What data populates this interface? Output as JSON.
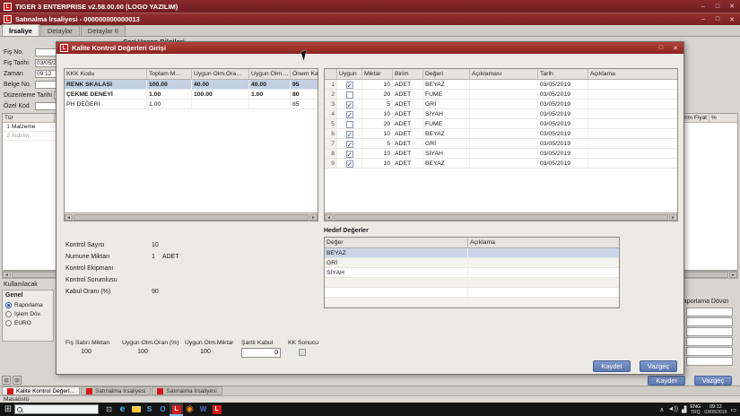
{
  "app": {
    "titlebar": "TIGER 3 ENTERPRISE v2.58.00.00 (LOGO YAZILIM)",
    "document_title": "Satınalma İrsaliyesi - 000000000000013",
    "window_controls": {
      "minimize": "–",
      "maximize": "□",
      "close": "✕"
    }
  },
  "glyphs": {
    "logo_letter": "L",
    "left": "◄",
    "right": "►",
    "tile": "▦",
    "chevron": "∧",
    "volume": "◄))",
    "network": "▟",
    "notification": "▭"
  },
  "doc_tabs": [
    {
      "label": "İrsaliye",
      "selected": true
    },
    {
      "label": "Detaylar"
    },
    {
      "label": "Detaylar II"
    }
  ],
  "form": {
    "section_title": "Cari Hesap Bilgileri",
    "fields": [
      {
        "label": "Fiş No.",
        "value": ""
      },
      {
        "label": "Fiş Tarihi",
        "value": "03/05/2019"
      },
      {
        "label": "Zaman",
        "value": "09:12"
      },
      {
        "label": "Belge No.",
        "value": ""
      },
      {
        "label": "Düzenleme Tarihi",
        "value": ""
      },
      {
        "label": "Özel Kod",
        "value": ""
      }
    ],
    "lines_grid": {
      "tur_header": "Tür",
      "rows": [
        {
          "no": "1",
          "tur": "Malzeme"
        },
        {
          "no": "2",
          "tur": "İndirim",
          "muted": true
        }
      ],
      "right_columns": [
        "Birim Fiyat",
        "%"
      ]
    },
    "currency_panel": {
      "title": "Kullanılacak",
      "group_label": "Genel",
      "options": [
        {
          "label": "Raporlama",
          "selected": true
        },
        {
          "label": "İşlem Döv."
        },
        {
          "label": "EURO"
        }
      ]
    },
    "right_label": "Raporlama Dövizi",
    "buttons": {
      "save": "Kaydet",
      "cancel": "Vazgeç"
    }
  },
  "dialog": {
    "title": "Kalite Kontrol Değerleri Girişi",
    "kkk_grid": {
      "columns": [
        "KKK Kodu",
        "Toplam M...",
        "Uygun Olm.Ora...",
        "Uygun Olm....",
        "Önem Kat..."
      ],
      "rows": [
        {
          "kod": "RENK SKALASI",
          "toplam": "100.00",
          "uygun_oran": "40.00",
          "uygun_miktar": "40.00",
          "onem": "95",
          "selected": true,
          "bold": true
        },
        {
          "kod": "ÇEKME DENEYİ",
          "toplam": "1.00",
          "uygun_oran": "100.00",
          "uygun_miktar": "1.00",
          "onem": "80",
          "bold": true
        },
        {
          "kod": "PH DEĞERİ",
          "toplam": "1.00",
          "uygun_oran": "",
          "uygun_miktar": "",
          "onem": "85"
        }
      ]
    },
    "detail_grid": {
      "columns": [
        "",
        "Uygun",
        "Miktar",
        "Birim",
        "Değeri",
        "Açıklaması",
        "Tarih",
        "Açıklama"
      ],
      "rows": [
        {
          "no": "1",
          "uygun": true,
          "miktar": "10",
          "birim": "ADET",
          "degeri": "BEYAZ",
          "aciklamasi": "",
          "tarih": "03/05/2019",
          "aciklama": ""
        },
        {
          "no": "2",
          "uygun": false,
          "miktar": "20",
          "birim": "ADET",
          "degeri": "FUME",
          "aciklamasi": "",
          "tarih": "03/05/2019",
          "aciklama": ""
        },
        {
          "no": "3",
          "uygun": true,
          "miktar": "5",
          "birim": "ADET",
          "degeri": "GRİ",
          "aciklamasi": "",
          "tarih": "03/05/2019",
          "aciklama": ""
        },
        {
          "no": "4",
          "uygun": true,
          "miktar": "10",
          "birim": "ADET",
          "degeri": "SİYAH",
          "aciklamasi": "",
          "tarih": "03/05/2019",
          "aciklama": ""
        },
        {
          "no": "5",
          "uygun": false,
          "miktar": "20",
          "birim": "ADET",
          "degeri": "FUME",
          "aciklamasi": "",
          "tarih": "03/05/2019",
          "aciklama": ""
        },
        {
          "no": "6",
          "uygun": true,
          "miktar": "10",
          "birim": "ADET",
          "degeri": "BEYAZ",
          "aciklamasi": "",
          "tarih": "03/05/2019",
          "aciklama": ""
        },
        {
          "no": "7",
          "uygun": true,
          "miktar": "5",
          "birim": "ADET",
          "degeri": "GRİ",
          "aciklamasi": "",
          "tarih": "03/05/2019",
          "aciklama": ""
        },
        {
          "no": "8",
          "uygun": true,
          "miktar": "10",
          "birim": "ADET",
          "degeri": "SİYAH",
          "aciklamasi": "",
          "tarih": "03/05/2019",
          "aciklama": ""
        },
        {
          "no": "9",
          "uygun": true,
          "miktar": "10",
          "birim": "ADET",
          "degeri": "BEYAZ",
          "aciklamasi": "",
          "tarih": "03/05/2019",
          "aciklama": ""
        }
      ]
    },
    "info_fields": [
      {
        "label": "Kontrol Sayısı",
        "value": "10",
        "unit": ""
      },
      {
        "label": "Numune Miktarı",
        "value": "1",
        "unit": "ADET"
      },
      {
        "label": "Kontrol Ekipmanı",
        "value": "",
        "unit": ""
      },
      {
        "label": "Kontrol Sorumlusu",
        "value": "",
        "unit": ""
      },
      {
        "label": "Kabul Oranı (%)",
        "value": "90",
        "unit": ""
      }
    ],
    "hedef": {
      "title": "Hedef Değerler",
      "columns": [
        "Değer",
        "Açıklama"
      ],
      "rows": [
        {
          "deger": "BEYAZ",
          "aciklama": "",
          "selected": true
        },
        {
          "deger": "GRİ",
          "aciklama": ""
        },
        {
          "deger": "SİYAH",
          "aciklama": ""
        },
        {},
        {},
        {}
      ]
    },
    "summary": {
      "items": [
        {
          "label": "Fiş Satırı Miktarı",
          "value": "100"
        },
        {
          "label": "Uygun Olm.Oran (%)",
          "value": "100"
        },
        {
          "label": "Uygun Olm.Miktar",
          "value": "100"
        }
      ],
      "sartli_kabul_label": "Şartlı Kabul",
      "sartli_kabul_value": "0",
      "kk_sonucu_label": "KK Sonucu"
    },
    "buttons": {
      "save": "Kaydet",
      "cancel": "Vazgeç"
    }
  },
  "workspace_tabs": [
    {
      "label": "Kalite Kontrol Değerl...",
      "selected": true
    },
    {
      "label": "Satınalma İrsaliyesi"
    },
    {
      "label": "Satınalma İrsaliyesi"
    }
  ],
  "statusbar": {
    "text": "Masaüstü"
  },
  "taskbar": {
    "start_glyph": "⊞",
    "apps": [
      {
        "glyph": "⊡",
        "name": "task-view-icon"
      },
      {
        "glyph": "e",
        "name": "edge-icon"
      },
      {
        "glyph": "",
        "name": "file-explorer-icon"
      },
      {
        "glyph": "S",
        "name": "skype-icon"
      },
      {
        "glyph": "O",
        "name": "outlook-icon"
      },
      {
        "glyph": "L",
        "name": "logo-tiger-icon",
        "selected": true
      },
      {
        "glyph": "◉",
        "name": "firefox-icon"
      },
      {
        "glyph": "W",
        "name": "word-icon"
      },
      {
        "glyph": "L",
        "name": "logo-app2-icon"
      }
    ],
    "tray": {
      "lang_top": "ENG",
      "lang_bottom": "TRQ",
      "time": "09:12",
      "date": "03/05/2019"
    }
  }
}
